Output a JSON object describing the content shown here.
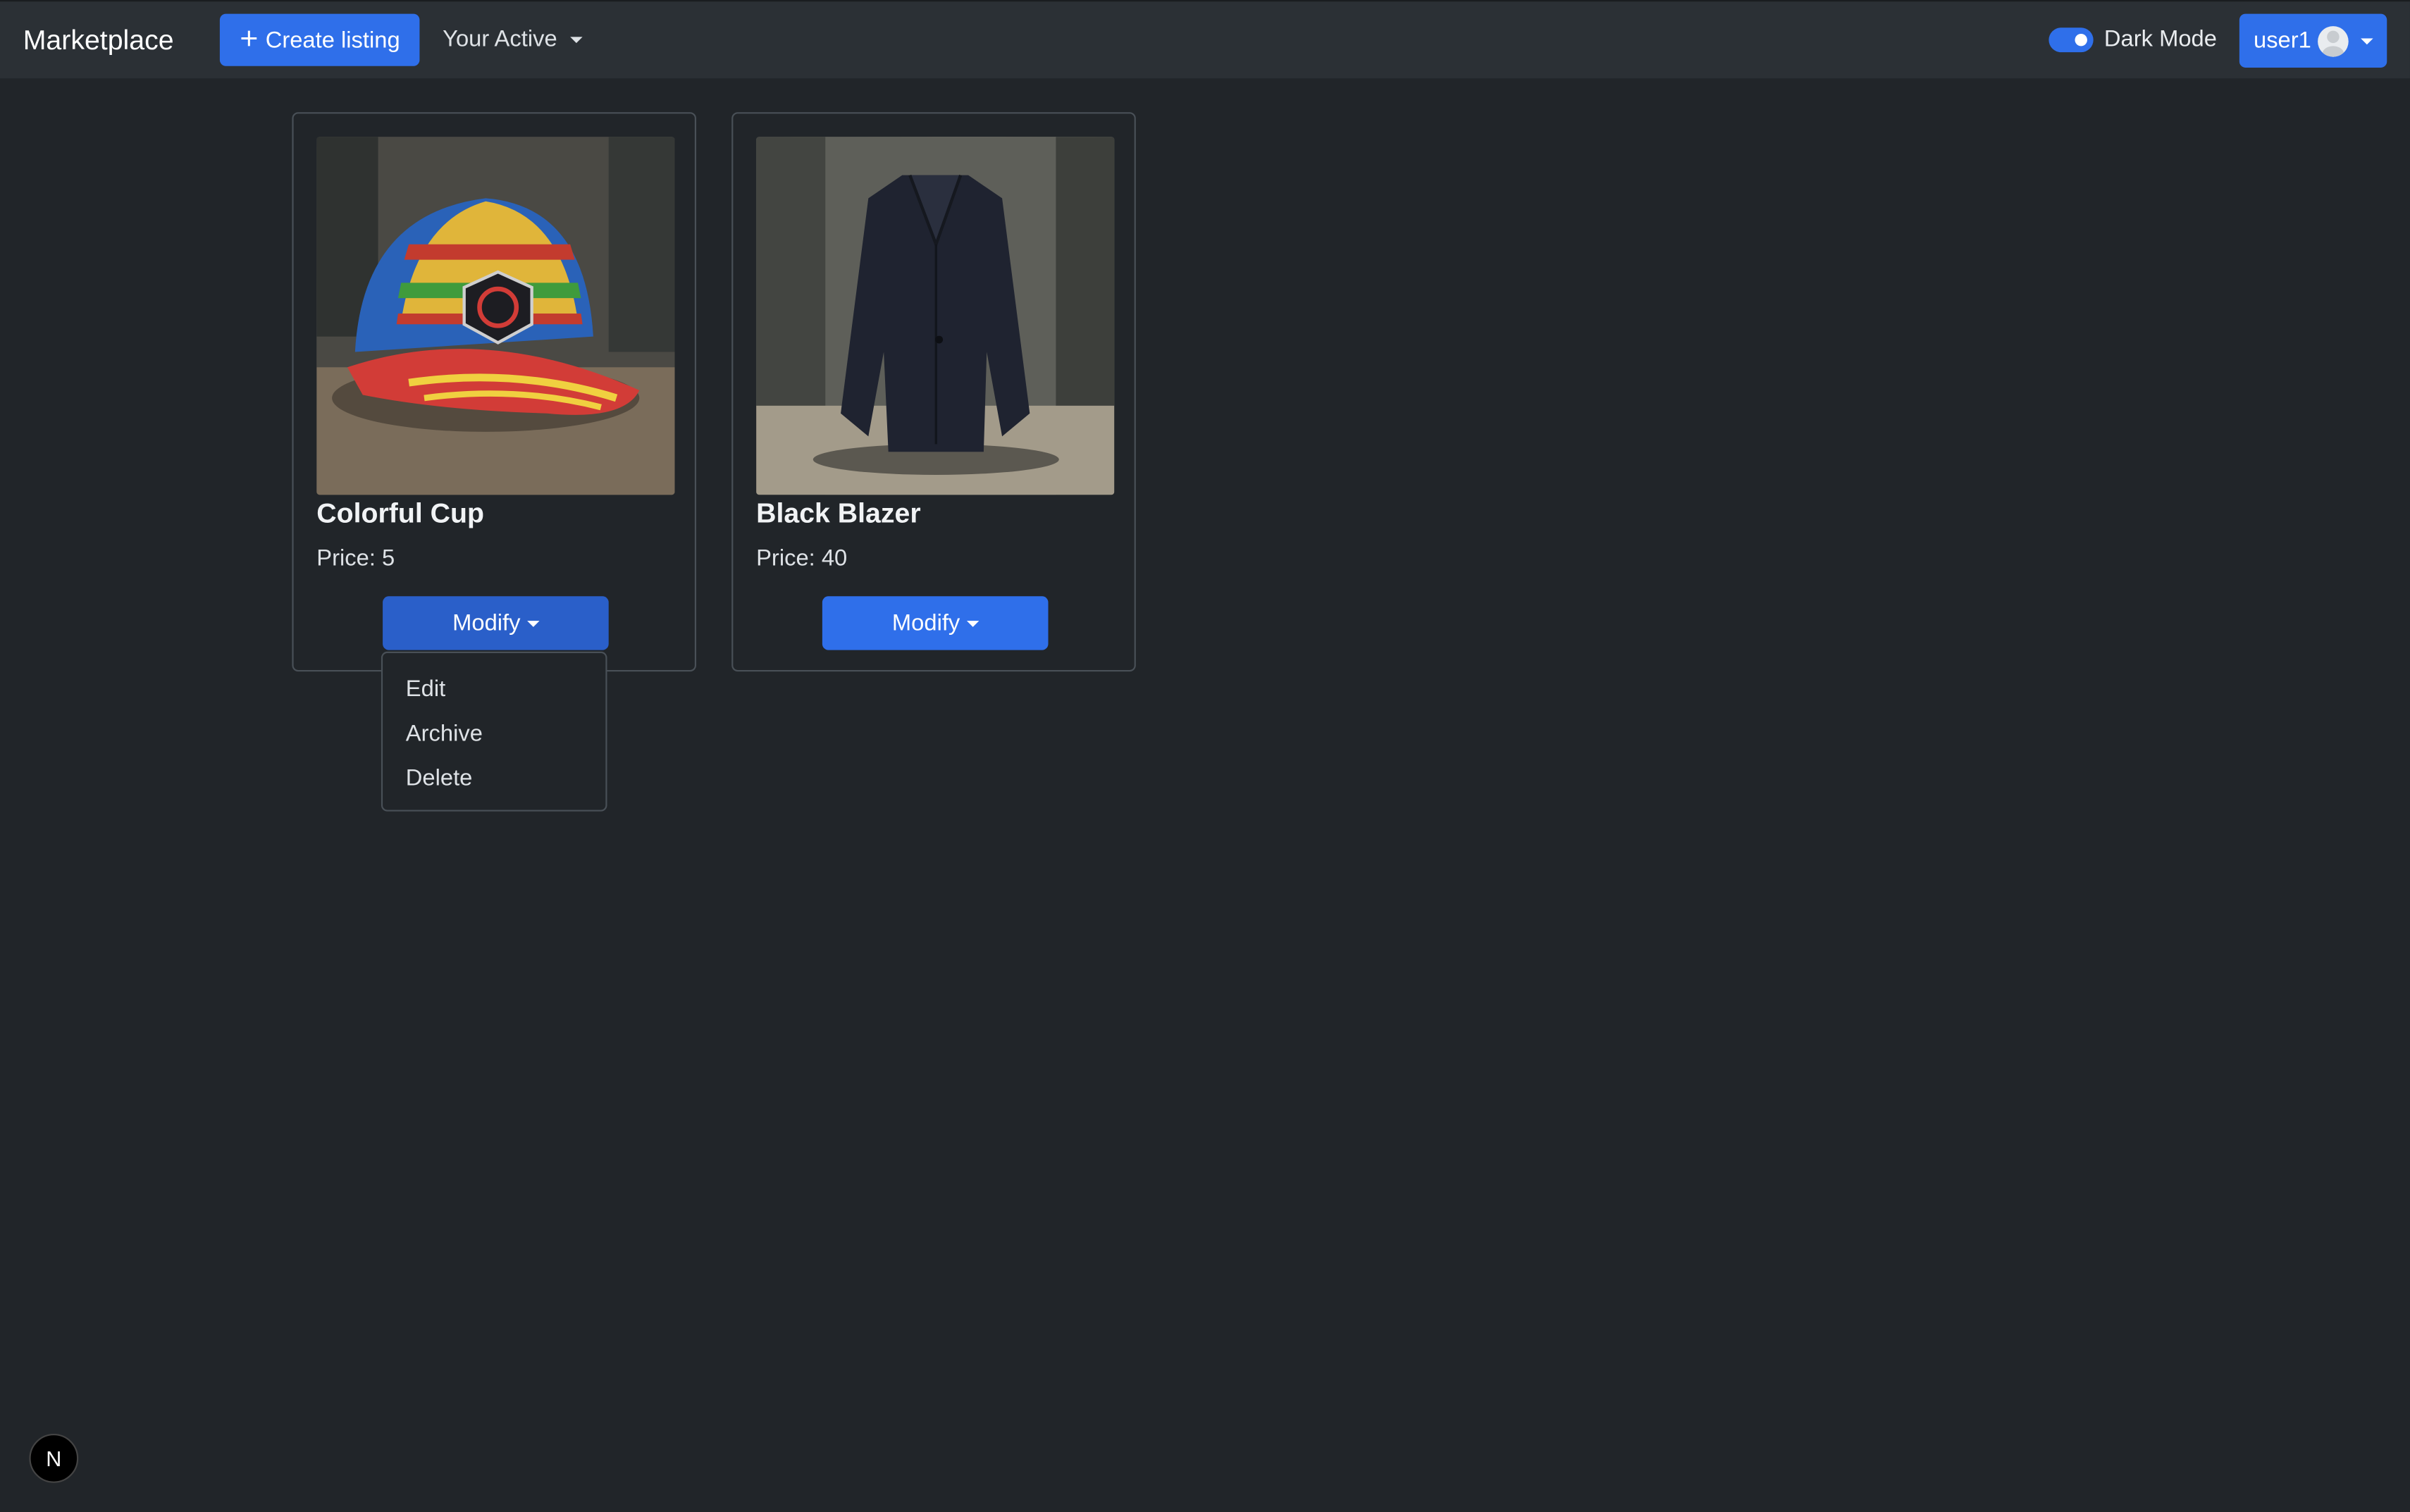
{
  "navbar": {
    "brand": "Marketplace",
    "create_label": "Create listing",
    "active_menu_label": "Your Active",
    "dark_mode_label": "Dark Mode",
    "dark_mode_on": true,
    "user_label": "user1"
  },
  "listings": [
    {
      "title": "Colorful Cup",
      "price": "Price: 5",
      "action_label": "Modify"
    },
    {
      "title": "Black Blazer",
      "price": "Price: 40",
      "action_label": "Modify"
    }
  ],
  "dropdown": {
    "items": [
      "Edit",
      "Archive",
      "Delete"
    ]
  },
  "colors": {
    "background": "#212529",
    "navbar": "#2b3035",
    "primary": "#2f6fea"
  },
  "badge_label": "N"
}
